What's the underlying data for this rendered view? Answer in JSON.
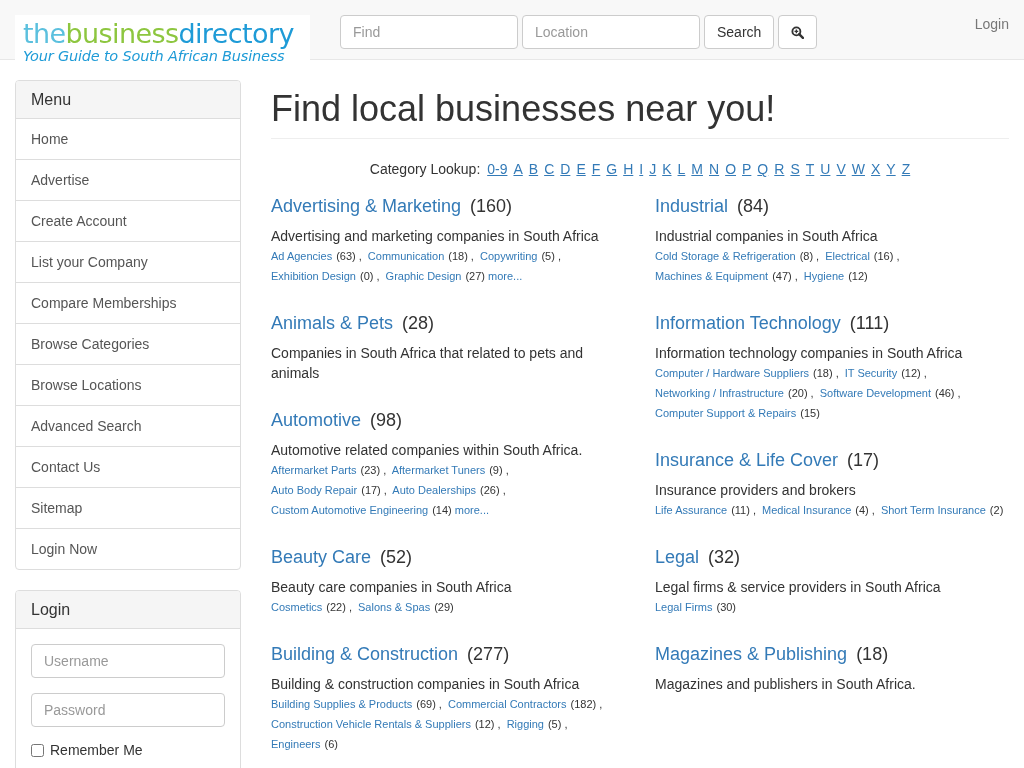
{
  "header": {
    "logo": {
      "parts": [
        {
          "text": "the",
          "color": "#5bc0de"
        },
        {
          "text": "business",
          "color": "#8dc63f"
        },
        {
          "text": "directory",
          "color": "#1e9bd7"
        }
      ],
      "tagline": "Your Guide to South African Business"
    },
    "search": {
      "find_placeholder": "Find",
      "location_placeholder": "Location",
      "button": "Search"
    },
    "login_link": "Login"
  },
  "sidebar": {
    "menu": {
      "title": "Menu",
      "items": [
        {
          "label": "Home"
        },
        {
          "label": "Advertise"
        },
        {
          "label": "Create Account"
        },
        {
          "label": "List your Company"
        },
        {
          "label": "Compare Memberships"
        },
        {
          "label": "Browse Categories"
        },
        {
          "label": "Browse Locations"
        },
        {
          "label": "Advanced Search"
        },
        {
          "label": "Contact Us"
        },
        {
          "label": "Sitemap"
        },
        {
          "label": "Login Now"
        }
      ]
    },
    "login": {
      "title": "Login",
      "username_placeholder": "Username",
      "password_placeholder": "Password",
      "remember": {
        "label": "Remember Me",
        "checked": false
      }
    }
  },
  "main": {
    "title": "Find local businesses near you!",
    "lookup": {
      "label": "Category Lookup:",
      "letters": [
        "0-9",
        "A",
        "B",
        "C",
        "D",
        "E",
        "F",
        "G",
        "H",
        "I",
        "J",
        "K",
        "L",
        "M",
        "N",
        "O",
        "P",
        "Q",
        "R",
        "S",
        "T",
        "U",
        "V",
        "W",
        "X",
        "Y",
        "Z"
      ]
    },
    "separator": ",",
    "columns": [
      [
        {
          "name": "Advertising & Marketing",
          "count": "(160)",
          "description": "Advertising and marketing companies in South Africa",
          "subcategories": [
            {
              "name": "Ad Agencies",
              "count": "(63)"
            },
            {
              "name": "Communication",
              "count": "(18)"
            },
            {
              "name": "Copywriting",
              "count": "(5)"
            },
            {
              "name": "Exhibition Design",
              "count": "(0)"
            },
            {
              "name": "Graphic Design",
              "count": "(27)"
            }
          ],
          "more": "more..."
        },
        {
          "name": "Animals & Pets",
          "count": "(28)",
          "description": "Companies in South Africa that related to pets and animals"
        },
        {
          "name": "Automotive",
          "count": "(98)",
          "description": "Automotive related companies within South Africa.",
          "subcategories": [
            {
              "name": "Aftermarket Parts",
              "count": "(23)"
            },
            {
              "name": "Aftermarket Tuners",
              "count": "(9)"
            },
            {
              "name": "Auto Body Repair",
              "count": "(17)"
            },
            {
              "name": "Auto Dealerships",
              "count": "(26)"
            },
            {
              "name": "Custom Automotive Engineering",
              "count": "(14)"
            }
          ],
          "more": "more..."
        },
        {
          "name": "Beauty Care",
          "count": "(52)",
          "description": "Beauty care companies in South Africa",
          "subcategories": [
            {
              "name": "Cosmetics",
              "count": "(22)"
            },
            {
              "name": "Salons & Spas",
              "count": "(29)"
            }
          ]
        },
        {
          "name": "Building & Construction",
          "count": "(277)",
          "description": "Building & construction companies in South Africa",
          "subcategories": [
            {
              "name": "Building Supplies & Products",
              "count": "(69)"
            },
            {
              "name": "Commercial Contractors",
              "count": "(182)"
            },
            {
              "name": "Construction Vehicle Rentals & Suppliers",
              "count": "(12)"
            },
            {
              "name": "Rigging",
              "count": "(5)"
            },
            {
              "name": "Engineers",
              "count": "(6)"
            }
          ]
        }
      ],
      [
        {
          "name": "Industrial",
          "count": "(84)",
          "description": "Industrial companies in South Africa",
          "subcategories": [
            {
              "name": "Cold Storage & Refrigeration",
              "count": "(8)"
            },
            {
              "name": "Electrical",
              "count": "(16)"
            },
            {
              "name": "Machines & Equipment",
              "count": "(47)"
            },
            {
              "name": "Hygiene",
              "count": "(12)"
            }
          ]
        },
        {
          "name": "Information Technology",
          "count": "(111)",
          "description": "Information technology companies in South Africa",
          "subcategories": [
            {
              "name": "Computer / Hardware Suppliers",
              "count": "(18)"
            },
            {
              "name": "IT Security",
              "count": "(12)"
            },
            {
              "name": "Networking / Infrastructure",
              "count": "(20)"
            },
            {
              "name": "Software Development",
              "count": "(46)"
            },
            {
              "name": "Computer Support & Repairs",
              "count": "(15)"
            }
          ]
        },
        {
          "name": "Insurance & Life Cover",
          "count": "(17)",
          "description": "Insurance providers and brokers",
          "subcategories": [
            {
              "name": "Life Assurance",
              "count": "(11)"
            },
            {
              "name": "Medical Insurance",
              "count": "(4)"
            },
            {
              "name": "Short Term Insurance",
              "count": "(2)"
            }
          ]
        },
        {
          "name": "Legal",
          "count": "(32)",
          "description": "Legal firms & service providers in South Africa",
          "subcategories": [
            {
              "name": "Legal Firms",
              "count": "(30)"
            }
          ]
        },
        {
          "name": "Magazines & Publishing",
          "count": "(18)",
          "description": "Magazines and publishers in South Africa."
        }
      ]
    ]
  }
}
